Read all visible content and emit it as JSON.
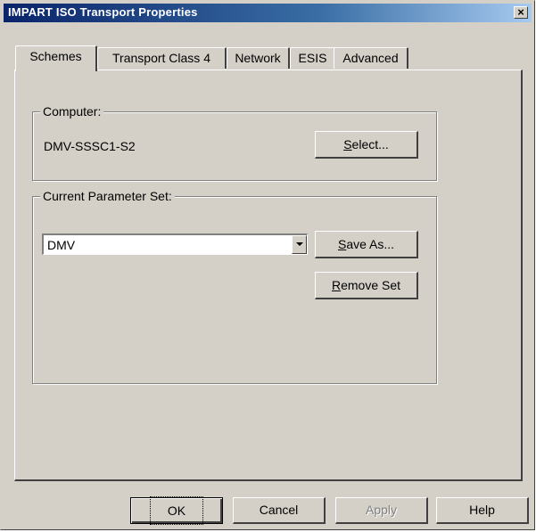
{
  "window": {
    "title": "IMPART ISO Transport Properties",
    "close_glyph": "×"
  },
  "tabs": [
    "Schemes",
    "Transport Class 4",
    "Network",
    "ESIS",
    "Advanced"
  ],
  "computer_group": {
    "legend": "Computer:",
    "value": "DMV-SSSC1-S2",
    "select_button": {
      "first": "S",
      "rest": "elect..."
    }
  },
  "param_group": {
    "legend": "Current Parameter Set:",
    "combo_value": "DMV",
    "save_as_button": {
      "first": "S",
      "rest": "ave As..."
    },
    "remove_set_button": {
      "first": "R",
      "rest": "emove Set"
    }
  },
  "footer": {
    "ok": "OK",
    "cancel": "Cancel",
    "apply": "Apply",
    "help": "Help"
  }
}
